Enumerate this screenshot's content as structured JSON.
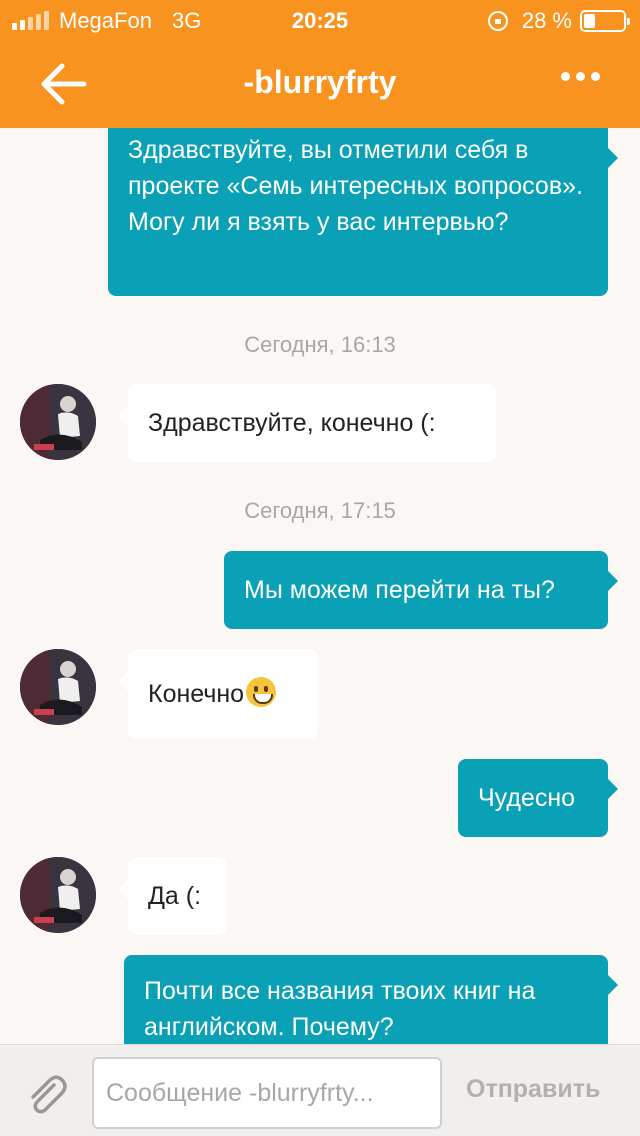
{
  "status_bar": {
    "carrier": "MegaFon",
    "network": "3G",
    "time": "20:25",
    "battery_percent": "28 %",
    "battery_level": 0.28
  },
  "header": {
    "title": "-blurryfrty",
    "back_icon": "arrow-left-icon",
    "more_icon": "more-horizontal-icon"
  },
  "colors": {
    "header": "#f7931e",
    "outgoing_bubble": "#0aa0b5",
    "incoming_bubble": "#ffffff",
    "background": "#faf7f4"
  },
  "messages": [
    {
      "direction": "out",
      "text": " Здравствуйте, вы отметили себя в проекте «Семь интересных вопросов». Могу ли я взять у вас интервью?"
    },
    {
      "type": "timestamp",
      "text": "Сегодня, 16:13"
    },
    {
      "direction": "in",
      "text": "Здравствуйте, конечно (:"
    },
    {
      "type": "timestamp",
      "text": "Сегодня, 17:15"
    },
    {
      "direction": "out",
      "text": "Мы можем перейти на ты?"
    },
    {
      "direction": "in",
      "text": "Конечно",
      "emoji": "grinning-face-icon"
    },
    {
      "direction": "out",
      "text": "Чудесно"
    },
    {
      "direction": "in",
      "text": "Да (:"
    },
    {
      "direction": "out",
      "text": "Почти все названия твоих книг на английском. Почему?"
    }
  ],
  "composer": {
    "placeholder": "Сообщение -blurryfrty...",
    "value": "",
    "send_label": "Отправить",
    "attach_icon": "paperclip-icon"
  }
}
